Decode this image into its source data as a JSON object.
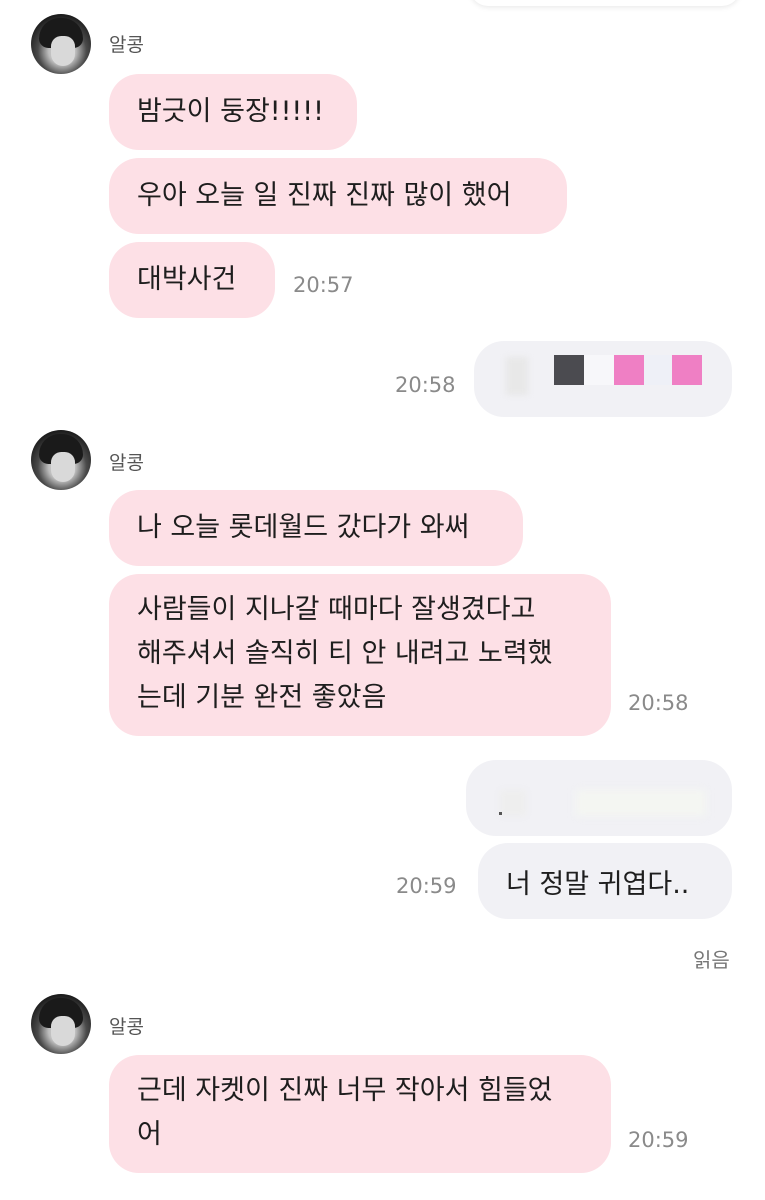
{
  "colors": {
    "incoming_bubble": "#fde0e6",
    "outgoing_bubble": "#f1f1f5",
    "timestamp": "#8a8a8a"
  },
  "groups": [
    {
      "sender": "알콩",
      "messages": [
        "밤긋이 둥장!!!!!",
        "우아 오늘 일 진짜 진짜 많이 했어",
        "대박사건"
      ],
      "time": "20:57"
    },
    {
      "outgoing_time": "20:58"
    },
    {
      "sender": "알콩",
      "messages": [
        "나 오늘 롯데월드 갔다가 와써",
        "사람들이 지나갈 때마다 잘생겼다고\n해주셔서 솔직히 티 안 내려고 노력했\n는데 기분 완전 좋았음"
      ],
      "time": "20:58"
    },
    {
      "outgoing_message": "너 정말 귀엽다..",
      "outgoing_time": "20:59",
      "read_label": "읽음"
    },
    {
      "sender": "알콩",
      "messages": [
        "근데 자켓이 진짜 너무 작아서 힘들었\n어"
      ],
      "time": "20:59"
    }
  ]
}
